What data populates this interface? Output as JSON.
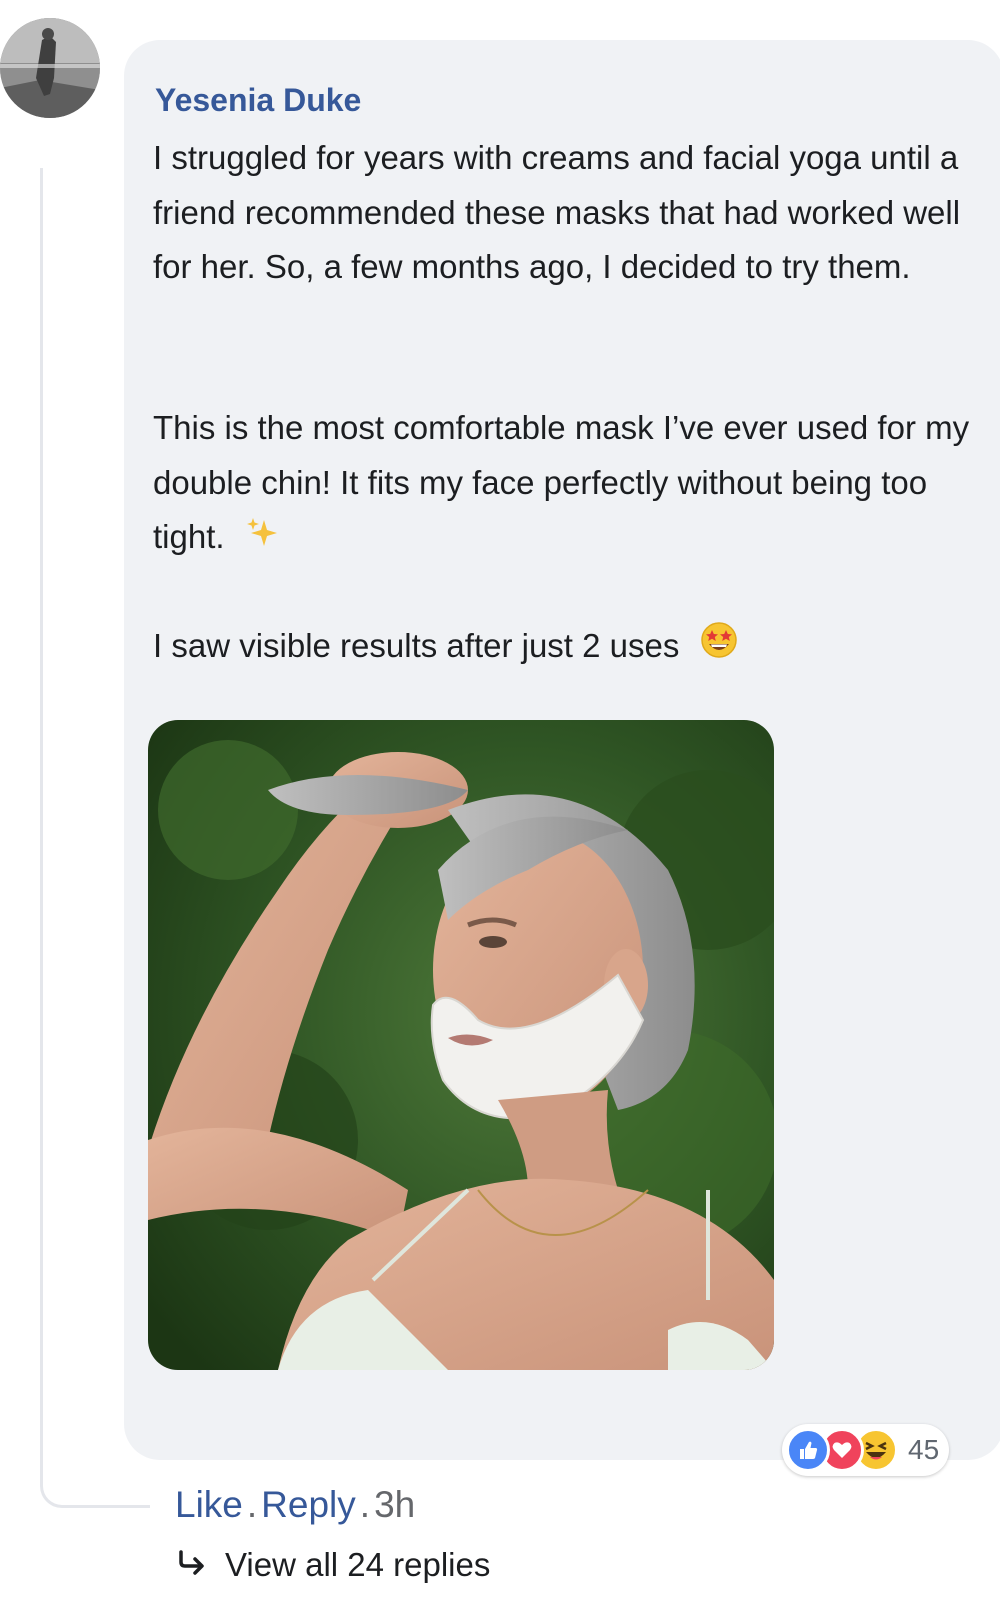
{
  "comment": {
    "author": "Yesenia Duke",
    "paragraphs": [
      "I struggled for years with creams and facial yoga until a friend recommended these masks that had worked well for her. So, a few months ago, I decided to try them.",
      "This is the most comfortable mask I’ve ever used for my double chin! It fits my face perfectly without being too tight.",
      "I saw visible results after just 2 uses"
    ],
    "paragraph_emoji_icons": [
      "sparkles-icon",
      "star-struck-emoji-icon"
    ],
    "photo_icon": "photo-woman-wearing-chin-mask"
  },
  "reactions": {
    "icons": [
      "like-reaction-icon",
      "love-reaction-icon",
      "haha-reaction-icon"
    ],
    "count": "45"
  },
  "actions": {
    "like_label": "Like",
    "separator": ".",
    "reply_label": "Reply",
    "time": "3h"
  },
  "replies": {
    "label": "View all 24 replies",
    "icon": "reply-arrow-icon"
  },
  "colors": {
    "link": "#365899",
    "bubble_bg": "#f0f2f5",
    "like_blue": "#4a86f7",
    "love_red": "#f0435c",
    "haha_yellow": "#f7c531"
  }
}
